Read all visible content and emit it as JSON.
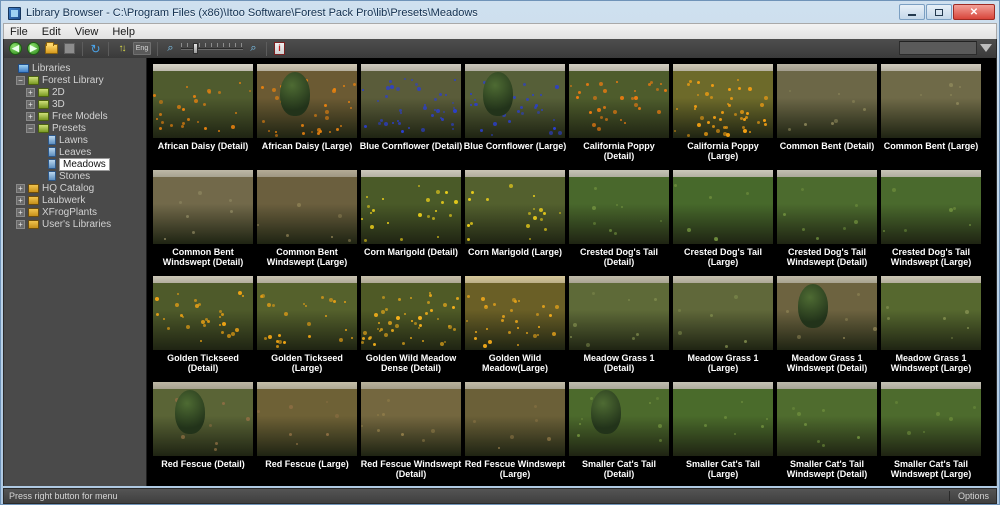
{
  "window": {
    "title": "Library Browser - C:\\Program Files (x86)\\Itoo Software\\Forest Pack Pro\\lib\\Presets\\Meadows",
    "minimize_label": "—",
    "maximize_label": "□",
    "close_label": "✕"
  },
  "menu": {
    "items": [
      {
        "label": "File"
      },
      {
        "label": "Edit"
      },
      {
        "label": "View"
      },
      {
        "label": "Help"
      }
    ]
  },
  "toolbar": {
    "back_label": "◀",
    "forward_label": "▶",
    "up_label": "",
    "stop_label": "",
    "refresh_label": "↻",
    "sort_label": "↑↓",
    "language_label": "Eng",
    "zoom_out_label": "⌕",
    "zoom_in_label": "⌕",
    "info_label": "i",
    "search_value": "",
    "search_placeholder": "",
    "filter_label": ""
  },
  "sidebar": {
    "items": [
      {
        "label": "Libraries",
        "depth": 0,
        "expander": "",
        "icon": "libraries-icon",
        "selected": false
      },
      {
        "label": "Forest Library",
        "depth": 1,
        "expander": "−",
        "icon": "folder-green-icon",
        "selected": false
      },
      {
        "label": "2D",
        "depth": 2,
        "expander": "+",
        "icon": "folder-green-icon",
        "selected": false
      },
      {
        "label": "3D",
        "depth": 2,
        "expander": "+",
        "icon": "folder-green-icon",
        "selected": false
      },
      {
        "label": "Free Models",
        "depth": 2,
        "expander": "+",
        "icon": "folder-green-icon",
        "selected": false
      },
      {
        "label": "Presets",
        "depth": 2,
        "expander": "−",
        "icon": "folder-green-icon",
        "selected": false
      },
      {
        "label": "Lawns",
        "depth": 3,
        "expander": "",
        "icon": "preset-icon",
        "selected": false
      },
      {
        "label": "Leaves",
        "depth": 3,
        "expander": "",
        "icon": "preset-icon",
        "selected": false
      },
      {
        "label": "Meadows",
        "depth": 3,
        "expander": "",
        "icon": "preset-icon",
        "selected": true
      },
      {
        "label": "Stones",
        "depth": 3,
        "expander": "",
        "icon": "preset-icon",
        "selected": false
      },
      {
        "label": "HQ Catalog",
        "depth": 1,
        "expander": "+",
        "icon": "folder-icon",
        "selected": false
      },
      {
        "label": "Laubwerk",
        "depth": 1,
        "expander": "+",
        "icon": "folder-icon",
        "selected": false
      },
      {
        "label": "XFrogPlants",
        "depth": 1,
        "expander": "+",
        "icon": "folder-icon",
        "selected": false
      },
      {
        "label": "User's Libraries",
        "depth": 1,
        "expander": "+",
        "icon": "folder-icon",
        "selected": false
      }
    ]
  },
  "gallery": {
    "items": [
      {
        "label": "African Daisy (Detail)",
        "sky": "#d8d4c8",
        "ground": "#4f5b2e",
        "flower": "#e8820f",
        "density": 26,
        "tree": false
      },
      {
        "label": "African Daisy (Large)",
        "sky": "#cfc7b4",
        "ground": "#6b5a33",
        "flower": "#e8820f",
        "density": 34,
        "tree": true
      },
      {
        "label": "Blue Cornflower (Detail)",
        "sky": "#cdc9bd",
        "ground": "#5a5c3a",
        "flower": "#2b3fd0",
        "density": 40,
        "tree": false
      },
      {
        "label": "Blue Cornflower (Large)",
        "sky": "#cac6ba",
        "ground": "#565f38",
        "flower": "#2b3fd0",
        "density": 34,
        "tree": true
      },
      {
        "label": "California Poppy (Detail)",
        "sky": "#d2cec2",
        "ground": "#4e5c2c",
        "flower": "#f07c10",
        "density": 30,
        "tree": false
      },
      {
        "label": "California Poppy (Large)",
        "sky": "#cfc9b6",
        "ground": "#6d6a2a",
        "flower": "#f6a012",
        "density": 46,
        "tree": false
      },
      {
        "label": "Common Bent (Detail)",
        "sky": "#b8b2a2",
        "ground": "#6c6747",
        "flower": "#8a8458",
        "density": 8,
        "tree": false
      },
      {
        "label": "Common Bent (Large)",
        "sky": "#cfcabc",
        "ground": "#6f6a48",
        "flower": "#8a8458",
        "density": 6,
        "tree": false
      },
      {
        "label": "Common Bent Windswept (Detail)",
        "sky": "#bdb8a6",
        "ground": "#72694a",
        "flower": "#8d8660",
        "density": 7,
        "tree": false
      },
      {
        "label": "Common Bent Windswept (Large)",
        "sky": "#b4ab96",
        "ground": "#6b5f3e",
        "flower": "#8a7d52",
        "density": 6,
        "tree": false
      },
      {
        "label": "Corn Marigold (Detail)",
        "sky": "#cdc9bc",
        "ground": "#4a5a28",
        "flower": "#f0d21a",
        "density": 22,
        "tree": false
      },
      {
        "label": "Corn Marigold (Large)",
        "sky": "#c9c4b4",
        "ground": "#53602e",
        "flower": "#f0d21a",
        "density": 18,
        "tree": false
      },
      {
        "label": "Crested Dog's Tail (Detail)",
        "sky": "#c6c4b6",
        "ground": "#49682c",
        "flower": "#6d8c3c",
        "density": 8,
        "tree": false
      },
      {
        "label": "Crested Dog's Tail (Large)",
        "sky": "#cbc8ba",
        "ground": "#47692b",
        "flower": "#6d8c3c",
        "density": 6,
        "tree": false
      },
      {
        "label": "Crested Dog's Tail Windswept (Detail)",
        "sky": "#c2bfb1",
        "ground": "#4c6b2e",
        "flower": "#6d8c3c",
        "density": 7,
        "tree": false
      },
      {
        "label": "Crested Dog's Tail Windswept (Large)",
        "sky": "#c8c5b7",
        "ground": "#4a6a2d",
        "flower": "#6d8c3c",
        "density": 6,
        "tree": false
      },
      {
        "label": "Golden Tickseed (Detail)",
        "sky": "#cbc6b6",
        "ground": "#4e5a2a",
        "flower": "#f0a414",
        "density": 28,
        "tree": false
      },
      {
        "label": "Golden Tickseed (Large)",
        "sky": "#c8c2b0",
        "ground": "#55612c",
        "flower": "#f0a414",
        "density": 24,
        "tree": false
      },
      {
        "label": "Golden Wild Meadow Dense (Detail)",
        "sky": "#c7c0ab",
        "ground": "#4f5a26",
        "flower": "#f5b01a",
        "density": 44,
        "tree": false
      },
      {
        "label": "Golden Wild Meadow(Large)",
        "sky": "#d6c79a",
        "ground": "#6a5f26",
        "flower": "#f0a81a",
        "density": 30,
        "tree": false
      },
      {
        "label": "Meadow Grass 1 (Detail)",
        "sky": "#c0bba9",
        "ground": "#5e6a38",
        "flower": "#7e8a4c",
        "density": 8,
        "tree": false
      },
      {
        "label": "Meadow Grass 1 (Large)",
        "sky": "#c5c0ae",
        "ground": "#60683a",
        "flower": "#7e8a4c",
        "density": 6,
        "tree": false
      },
      {
        "label": "Meadow Grass 1 Windswept (Detail)",
        "sky": "#bfb9a6",
        "ground": "#6d6340",
        "flower": "#8a7f52",
        "density": 7,
        "tree": true
      },
      {
        "label": "Meadow Grass 1 Windswept (Large)",
        "sky": "#cbc6b4",
        "ground": "#56682f",
        "flower": "#7e8a4c",
        "density": 6,
        "tree": false
      },
      {
        "label": "Red Fescue (Detail)",
        "sky": "#bdb7a4",
        "ground": "#5a6436",
        "flower": "#8a6d42",
        "density": 9,
        "tree": true
      },
      {
        "label": "Red Fescue (Large)",
        "sky": "#c5bfa9",
        "ground": "#6e6136",
        "flower": "#8a6d42",
        "density": 7,
        "tree": false
      },
      {
        "label": "Red Fescue Windswept (Detail)",
        "sky": "#b9b29c",
        "ground": "#74673f",
        "flower": "#8e7b48",
        "density": 8,
        "tree": false
      },
      {
        "label": "Red Fescue Windswept (Large)",
        "sky": "#c2bca8",
        "ground": "#6b6038",
        "flower": "#8a7344",
        "density": 6,
        "tree": false
      },
      {
        "label": "Smaller Cat's Tail (Detail)",
        "sky": "#c0bdaf",
        "ground": "#4c6a2c",
        "flower": "#6d8c3c",
        "density": 8,
        "tree": true
      },
      {
        "label": "Smaller Cat's Tail (Large)",
        "sky": "#c6c3b5",
        "ground": "#4a6b2b",
        "flower": "#6d8c3c",
        "density": 6,
        "tree": false
      },
      {
        "label": "Smaller Cat's Tail Windswept (Detail)",
        "sky": "#bcb9ab",
        "ground": "#4f6c2e",
        "flower": "#6d8c3c",
        "density": 7,
        "tree": false
      },
      {
        "label": "Smaller Cat's Tail Windswept (Large)",
        "sky": "#c4c1b3",
        "ground": "#4d6b2d",
        "flower": "#6d8c3c",
        "density": 6,
        "tree": false
      }
    ]
  },
  "statusbar": {
    "message": "Press right button for menu",
    "options_label": "Options"
  }
}
